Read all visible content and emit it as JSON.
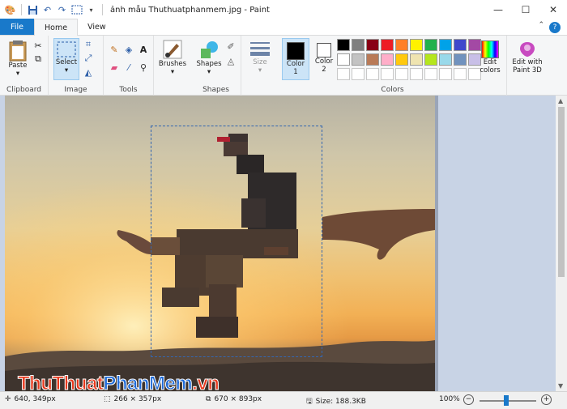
{
  "window": {
    "title": "ảnh mẫu Thuthuatphanmem.jpg - Paint",
    "minimize": "—",
    "maximize": "☐",
    "close": "✕"
  },
  "tabs": [
    {
      "label": "File"
    },
    {
      "label": "Home"
    },
    {
      "label": "View"
    }
  ],
  "ribbon": {
    "clipboard": {
      "paste_label": "Paste",
      "group_label": "Clipboard"
    },
    "image": {
      "select_label": "Select",
      "group_label": "Image"
    },
    "tools": {
      "group_label": "Tools"
    },
    "brushes": {
      "label": "Brushes"
    },
    "shapes": {
      "label": "Shapes",
      "group_label": "Shapes"
    },
    "size": {
      "label": "Size"
    },
    "color1": {
      "label": "Color",
      "num": "1",
      "color": "#000000"
    },
    "color2": {
      "label": "Color",
      "num": "2",
      "color": "#ffffff"
    },
    "colors": {
      "group_label": "Colors"
    },
    "edit_colors": {
      "label1": "Edit",
      "label2": "colors"
    },
    "paint3d": {
      "label1": "Edit with",
      "label2": "Paint 3D"
    }
  },
  "palette": [
    "#000000",
    "#7f7f7f",
    "#880015",
    "#ed1c24",
    "#ff7f27",
    "#fff200",
    "#22b14c",
    "#00a2e8",
    "#3f48cc",
    "#a349a4",
    "#ffffff",
    "#c3c3c3",
    "#b97a57",
    "#ffaec9",
    "#ffc90e",
    "#efe4b0",
    "#b5e61d",
    "#99d9ea",
    "#7092be",
    "#c8bfe7"
  ],
  "status": {
    "cursor": "640, 349px",
    "selection": "266 × 357px",
    "dimensions": "670 × 893px",
    "size": "Size: 188.3KB",
    "zoom": "100%",
    "zoom_fraction": 0.47
  },
  "watermark": {
    "part1": "ThuThuat",
    "part2": "PhanMem",
    "part3": ".vn"
  }
}
